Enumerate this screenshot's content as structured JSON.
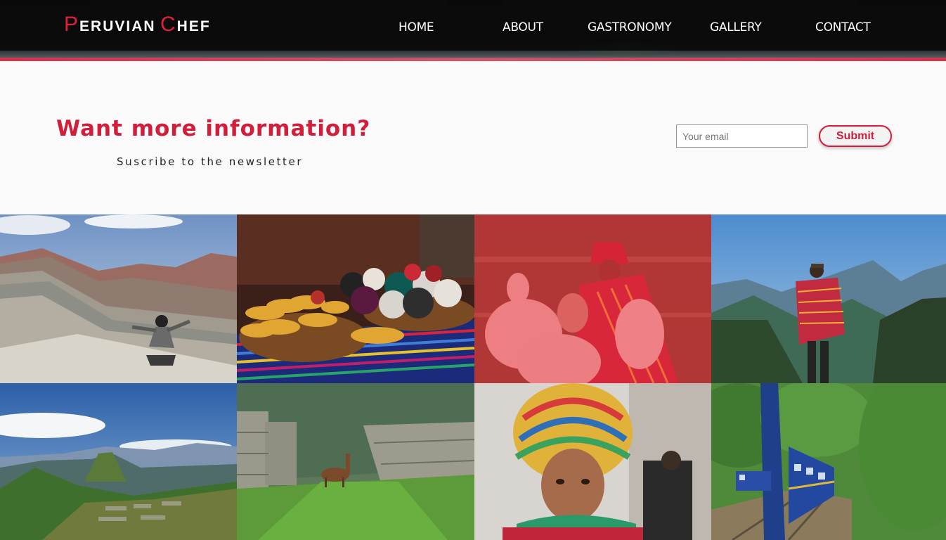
{
  "header": {
    "logo": {
      "first_cap": "P",
      "first_rest": "ERUVIAN",
      "second_cap": "C",
      "second_rest": "HEF"
    },
    "nav": [
      {
        "label": "HOME"
      },
      {
        "label": "ABOUT"
      },
      {
        "label": "GASTRONOMY"
      },
      {
        "label": "GALLERY"
      },
      {
        "label": "CONTACT"
      }
    ]
  },
  "newsletter": {
    "title": "Want more information?",
    "subtitle": "Suscribe to the newsletter",
    "email_placeholder": "Your email",
    "email_value": "",
    "submit_label": "Submit"
  },
  "gallery": {
    "images": [
      {
        "subject": "rainbow-mountain-photo"
      },
      {
        "subject": "corn-and-yarn-photo"
      },
      {
        "subject": "llama-herder-photo"
      },
      {
        "subject": "andes-hiker-photo"
      },
      {
        "subject": "machu-picchu-photo"
      },
      {
        "subject": "llama-ruins-photo"
      },
      {
        "subject": "child-in-chullo-photo"
      },
      {
        "subject": "blue-train-photo"
      }
    ],
    "hovered_index": 2
  },
  "colors": {
    "accent": "#d11e3a",
    "nav_background": "#0a0a0a",
    "page_background": "#fafafa",
    "hover_overlay": "#eb283c"
  }
}
